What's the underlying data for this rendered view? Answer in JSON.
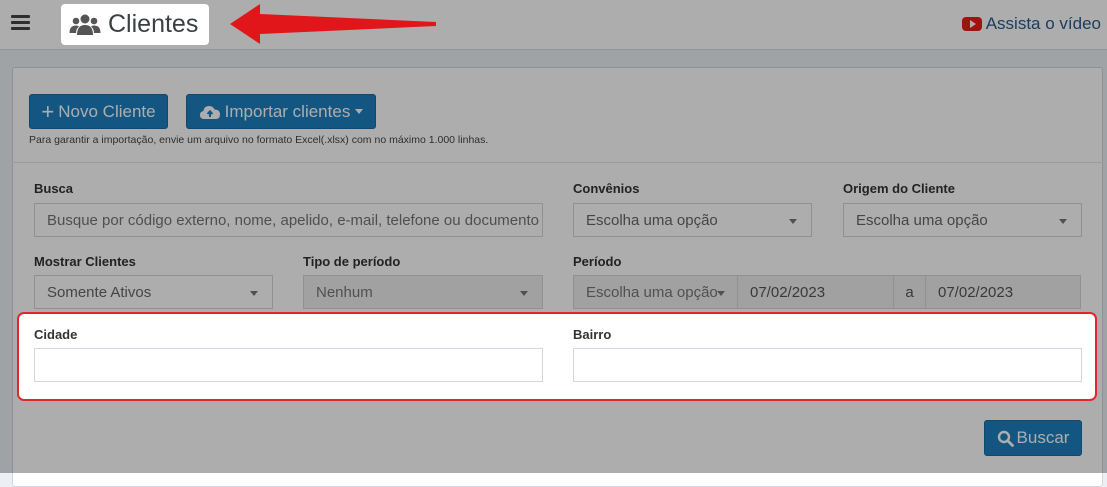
{
  "header": {
    "title": "Clientes",
    "video_link": "Assista o vídeo",
    "icons": {
      "menu": "hamburger-icon",
      "title": "users-icon",
      "video": "youtube-icon"
    }
  },
  "actions": {
    "new_client": "+ Novo Cliente",
    "new_client_label": "Novo Cliente",
    "import": "Importar clientes",
    "import_hint": "Para garantir a importação, envie um arquivo no formato Excel(.xlsx) com no máximo 1.000 linhas."
  },
  "filters": {
    "busca": {
      "label": "Busca",
      "placeholder": "Busque por código externo, nome, apelido, e-mail, telefone ou documento"
    },
    "convenios": {
      "label": "Convênios",
      "value": "Escolha uma opção"
    },
    "origem": {
      "label": "Origem do Cliente",
      "value": "Escolha uma opção"
    },
    "mostrar": {
      "label": "Mostrar Clientes",
      "value": "Somente Ativos"
    },
    "tipo_periodo": {
      "label": "Tipo de período",
      "value": "Nenhum"
    },
    "periodo": {
      "label": "Período",
      "select": "Escolha uma opção",
      "start": "07/02/2023",
      "separator": "a",
      "end": "07/02/2023"
    },
    "cidade": {
      "label": "Cidade",
      "value": ""
    },
    "bairro": {
      "label": "Bairro",
      "value": ""
    }
  },
  "search_button": "Buscar",
  "colors": {
    "primary": "#1e7fc0",
    "highlight": "#e3262b",
    "arrow": "#e0161b"
  }
}
